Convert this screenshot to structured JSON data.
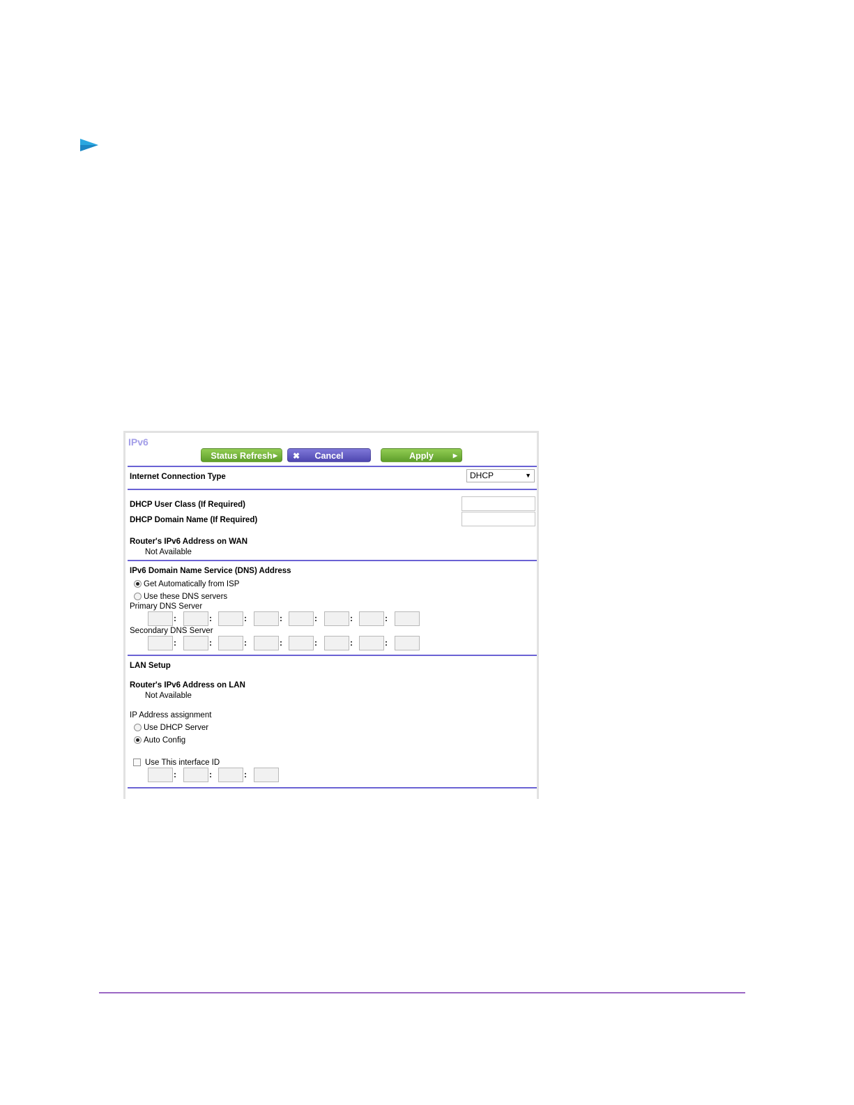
{
  "colors": {
    "accent": "#6a62d4",
    "bullet": "#2aa7e0",
    "title": "#a39ee8",
    "footer_rule": "#9b67c4"
  },
  "panel": {
    "title": "IPv6",
    "buttons": {
      "status_refresh": "Status Refresh",
      "cancel": "Cancel",
      "apply": "Apply"
    },
    "connection": {
      "label": "Internet Connection Type",
      "selected": "DHCP"
    },
    "dhcp": {
      "user_class_label": "DHCP User Class (If Required)",
      "domain_name_label": "DHCP Domain Name (If Required)",
      "user_class_value": "",
      "domain_name_value": ""
    },
    "wan": {
      "label": "Router's IPv6 Address on WAN",
      "value": "Not Available"
    },
    "dns": {
      "heading": "IPv6 Domain Name Service (DNS) Address",
      "option_auto": "Get Automatically from ISP",
      "option_manual": "Use these DNS servers",
      "selected": "auto",
      "primary_label": "Primary DNS Server",
      "secondary_label": "Secondary DNS Server",
      "separator": ":"
    },
    "lan": {
      "heading": "LAN Setup",
      "address_label": "Router's IPv6 Address on LAN",
      "address_value": "Not Available",
      "assignment_label": "IP Address assignment",
      "option_dhcp": "Use DHCP Server",
      "option_auto": "Auto Config",
      "selected": "auto",
      "interface_id_label": "Use This interface ID",
      "interface_id_checked": false
    }
  }
}
